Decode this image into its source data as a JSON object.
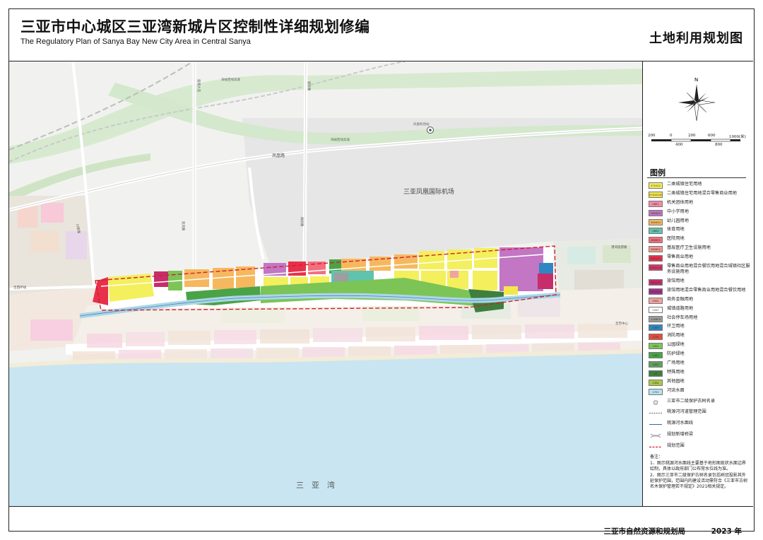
{
  "header": {
    "title_cn": "三亚市中心城区三亚湾新城片区控制性详细规划修编",
    "title_en": "The Regulatory Plan of Sanya Bay New City Area in Central Sanya",
    "map_title": "土地利用规划图"
  },
  "map": {
    "airport_label": "三亚凤凰国际机场",
    "bay_label": "三　亚　湾",
    "road_upper": "凤凰路",
    "highway_label": "海榆西线高速",
    "highway_label_2": "海榆西线高速",
    "station_label": "凤凰机场站",
    "road_east_upper": "港湾旅游路",
    "road_east_lower": "至市中心",
    "road_west": "至西环线",
    "road_left_vertical": "川南路",
    "road_north_1": "鹿城大道",
    "road_north_2": "鹿岭路",
    "road_n1": "新风路",
    "road_n2": "梅新路"
  },
  "scale": {
    "ticks": [
      "200",
      "0",
      "200",
      "600",
      "1000(米)",
      "400",
      "800"
    ],
    "north_symbol": "N"
  },
  "legend": {
    "heading": "图例",
    "items": [
      {
        "code": "070102",
        "label": "二类城镇住宅用地",
        "color": "#f4ef5c"
      },
      {
        "code": "070102/0901",
        "label": "二类城镇住宅用地混合零售商业用地",
        "color": "#f2e84a"
      },
      {
        "code": "0801",
        "label": "机关团体用地",
        "color": "#f28ca6"
      },
      {
        "code": "080403",
        "label": "中小学用地",
        "color": "#c276c4"
      },
      {
        "code": "080404",
        "label": "幼儿园用地",
        "color": "#f6b85e"
      },
      {
        "code": "0805",
        "label": "体育用地",
        "color": "#5fc3ae"
      },
      {
        "code": "080601",
        "label": "医院用地",
        "color": "#f46f7e"
      },
      {
        "code": "080602",
        "label": "基层医疗卫生设施用地",
        "color": "#f59a90"
      },
      {
        "code": "090101",
        "label": "零售商业用地",
        "color": "#e8304a"
      },
      {
        "code": "090101/0902",
        "label": "零售商业用地混合餐饮用地混合城镇社区服务设施用地",
        "color": "#d8356b"
      },
      {
        "code": "090104",
        "label": "旅馆用地",
        "color": "#c62d6a"
      },
      {
        "code": "090104/090101",
        "label": "旅馆用地混合零售商业用地混合餐饮用地",
        "color": "#a6308a"
      },
      {
        "code": "0902",
        "label": "商务金融用地",
        "color": "#f0a3a0"
      },
      {
        "code": "1207",
        "label": "城镇道路用地",
        "color": "#ffffff"
      },
      {
        "code": "120803",
        "label": "社会停车场用地",
        "color": "#9e9e9e"
      },
      {
        "code": "1309",
        "label": "环卫用地",
        "color": "#2f86c2"
      },
      {
        "code": "1310",
        "label": "消防用地",
        "color": "#e84b3c"
      },
      {
        "code": "1401",
        "label": "公园绿地",
        "color": "#7cc456"
      },
      {
        "code": "1402",
        "label": "防护绿地",
        "color": "#4aa346"
      },
      {
        "code": "1403",
        "label": "广场用地",
        "color": "#5ea15c"
      },
      {
        "code": "15",
        "label": "特殊用地",
        "color": "#3e7f3e"
      },
      {
        "code": "2304",
        "label": "其他园地",
        "color": "#a9c94a"
      },
      {
        "code": "1701",
        "label": "河流水面",
        "color": "#b8e2ec"
      }
    ],
    "symbols": [
      {
        "label": "三亚市二级保护古树名录",
        "kind": "circle"
      },
      {
        "label": "桃源河河道管理范围",
        "kind": "dash-black"
      },
      {
        "label": "桃源河水面线",
        "kind": "blue-line"
      },
      {
        "label": "规划新增桥梁",
        "kind": "bridge"
      },
      {
        "label": "规划范围",
        "kind": "dash-red"
      }
    ]
  },
  "notes": {
    "heading": "备注：",
    "n1": "1、图示桃源河水面线主要基于地形图现状水面边界绘制，具体以政府部门公布常水位线为准。",
    "n2": "2、图示三亚市二级保护古树名录包括树冠投影其外延保护范围，范围内的建设活动需符合《三亚市古树名木保护管理若干规定》2021相关规定。"
  },
  "footer": {
    "authority": "三亚市自然资源和规划局",
    "year": "2023 年"
  }
}
